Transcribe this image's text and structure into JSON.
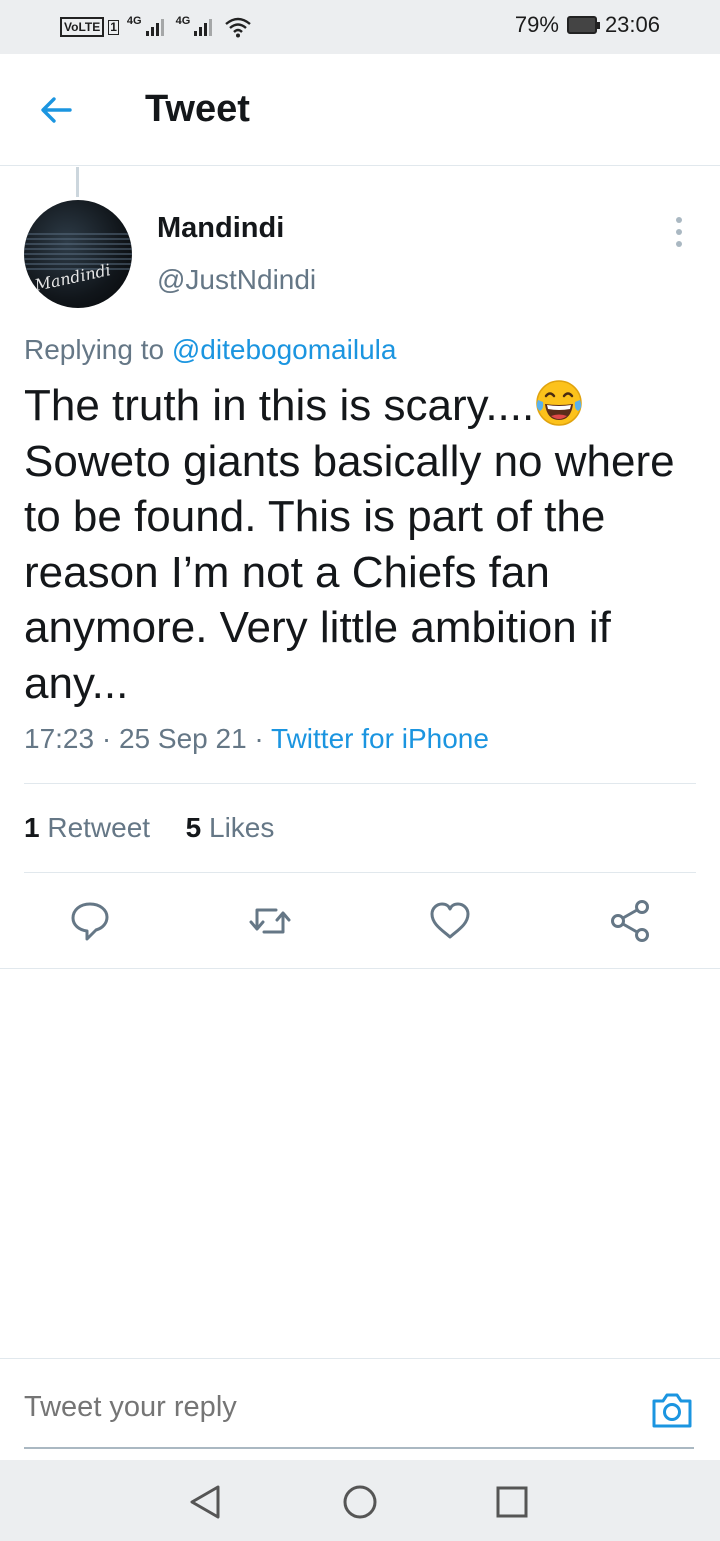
{
  "status_bar": {
    "volte": "VoLTE",
    "sim": "1",
    "net1": "4G",
    "net2": "4G",
    "battery_percent": "79%",
    "time": "23:06"
  },
  "header": {
    "title": "Tweet",
    "back_icon": "arrow-left-icon"
  },
  "tweet": {
    "author_name": "Mandindi",
    "author_handle": "@JustNdindi",
    "avatar_signature": "Mandindi",
    "replying_prefix": "Replying to",
    "replying_to": "@ditebogomailula",
    "text_before_emoji": "The truth in this is scary....",
    "emoji": "face-with-tears-of-joy",
    "text_after_emoji": "Soweto giants basically no where to be found. This is part of the reason I’m not a Chiefs fan anymore. Very little ambition if any...",
    "time": "17:23",
    "date": "25 Sep 21",
    "source": "Twitter for iPhone",
    "retweet_count": "1",
    "retweet_label": "Retweet",
    "like_count": "5",
    "like_label": "Likes"
  },
  "actions": [
    "reply-icon",
    "retweet-icon",
    "like-icon",
    "share-icon"
  ],
  "reply_bar": {
    "placeholder": "Tweet your reply",
    "camera_icon": "camera-icon"
  },
  "nav_bar": [
    "back-triangle-icon",
    "home-circle-icon",
    "recents-square-icon"
  ],
  "colors": {
    "accent": "#1b95e0",
    "text_primary": "#14171a",
    "text_secondary": "#657786",
    "divider": "#e1e8ed",
    "system_bar": "#eceef0"
  }
}
